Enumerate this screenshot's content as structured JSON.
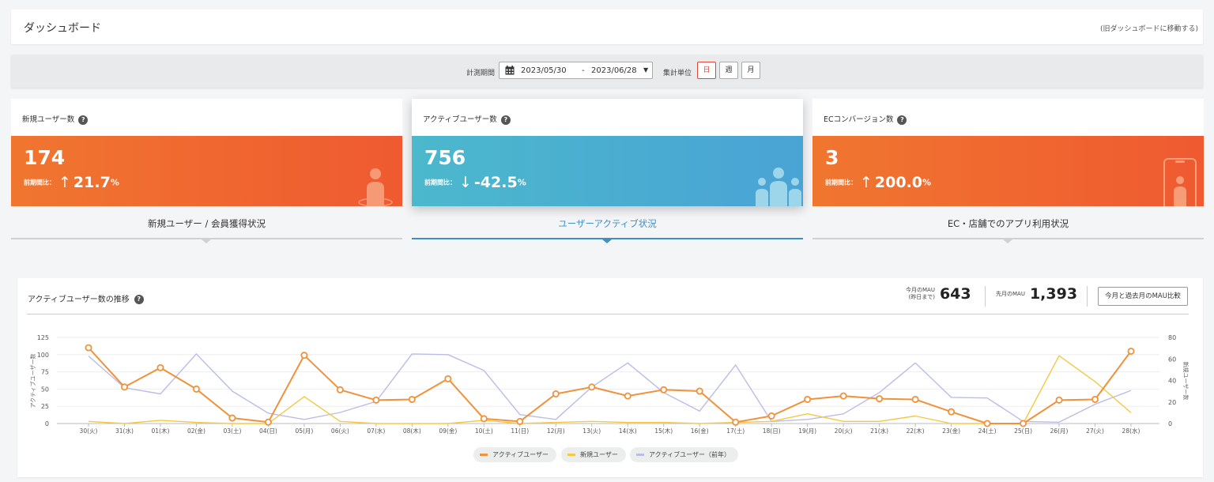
{
  "header": {
    "title": "ダッシュボード",
    "old_link": "(旧ダッシュボードに移動する)"
  },
  "filter": {
    "period_label": "計測期間",
    "date_from": "2023/05/30",
    "date_sep": "-",
    "date_to": "2023/06/28",
    "unit_label": "集計単位",
    "units": [
      "日",
      "週",
      "月"
    ],
    "active_unit": "日"
  },
  "cards": [
    {
      "title": "新規ユーザー数",
      "value": "174",
      "compare_label": "前期間比：",
      "arrow": "↑",
      "change": "21.7",
      "percent": "%",
      "color": "#f06a30"
    },
    {
      "title": "アクティブユーザー数",
      "value": "756",
      "compare_label": "前期間比：",
      "arrow": "↓",
      "change": "-42.5",
      "percent": "%",
      "color": "#4ab0d0"
    },
    {
      "title": "ECコンバージョン数",
      "value": "3",
      "compare_label": "前期間比：",
      "arrow": "↑",
      "change": "200.0",
      "percent": "%",
      "color": "#f06a30"
    }
  ],
  "tabs": [
    {
      "label": "新規ユーザー / 会員獲得状況"
    },
    {
      "label": "ユーザーアクティブ状況"
    },
    {
      "label": "EC・店舗でのアプリ利用状況"
    }
  ],
  "panel": {
    "title": "アクティブユーザー数の推移",
    "mau_current_label_1": "今月のMAU",
    "mau_current_label_2": "(昨日まで)",
    "mau_current": "643",
    "mau_last_label": "先月のMAU",
    "mau_last": "1,393",
    "compare_button": "今月と過去月のMAU比較"
  },
  "chart_data": {
    "type": "line",
    "categories": [
      "30(火)",
      "31(水)",
      "01(木)",
      "02(金)",
      "03(土)",
      "04(日)",
      "05(月)",
      "06(火)",
      "07(水)",
      "08(木)",
      "09(金)",
      "10(土)",
      "11(日)",
      "12(月)",
      "13(火)",
      "14(水)",
      "15(木)",
      "16(金)",
      "17(土)",
      "18(日)",
      "19(月)",
      "20(火)",
      "21(水)",
      "22(木)",
      "23(金)",
      "24(土)",
      "25(日)",
      "26(月)",
      "27(火)",
      "28(水)"
    ],
    "ylabel_left": "アクティブユーザー数",
    "ylabel_right": "新規ユーザー数",
    "ylim_left": [
      0,
      125
    ],
    "yticks_left": [
      0,
      25,
      50,
      75,
      100,
      125
    ],
    "ylim_right": [
      0,
      80
    ],
    "yticks_right": [
      0,
      20,
      40,
      60,
      80
    ],
    "grid": true,
    "legend_position": "bottom-center",
    "series": [
      {
        "name": "アクティブユーザー",
        "axis": "left",
        "color": "#f0923b",
        "markers": true,
        "values": [
          110,
          53,
          81,
          50,
          8,
          2,
          99,
          49,
          34,
          35,
          65,
          7,
          3,
          43,
          53,
          40,
          49,
          47,
          2,
          11,
          35,
          40,
          36,
          35,
          17,
          0,
          0,
          34,
          35,
          105
        ]
      },
      {
        "name": "新規ユーザー",
        "axis": "right",
        "color": "#f5c842",
        "markers": false,
        "values": [
          2,
          0,
          3,
          1,
          0,
          0,
          25,
          2,
          0,
          0,
          0,
          3,
          0,
          1,
          2,
          1,
          1,
          0,
          1,
          2,
          9,
          2,
          2,
          7,
          0,
          0,
          0,
          63,
          39,
          10
        ]
      },
      {
        "name": "アクティブユーザー（前年）",
        "axis": "left",
        "color": "#b9bde8",
        "markers": false,
        "values": [
          98,
          52,
          43,
          101,
          47,
          15,
          6,
          16,
          32,
          101,
          100,
          77,
          13,
          6,
          53,
          88,
          45,
          18,
          85,
          3,
          6,
          14,
          45,
          88,
          38,
          37,
          3,
          2,
          28,
          48
        ]
      }
    ]
  }
}
